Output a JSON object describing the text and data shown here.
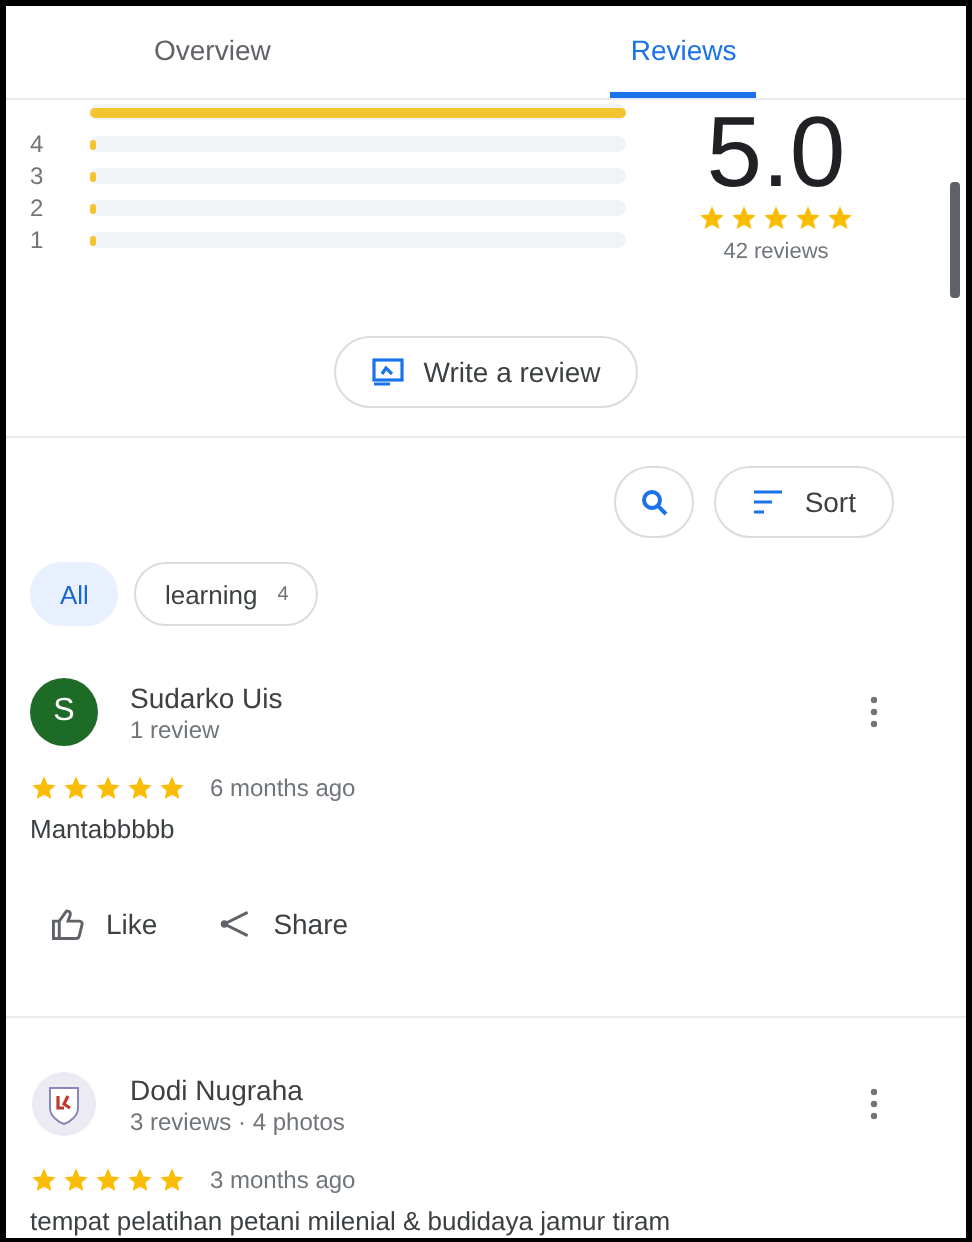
{
  "tabs": [
    {
      "label": "Overview",
      "selected": false
    },
    {
      "label": "Reviews",
      "selected": true
    }
  ],
  "histogram": [
    {
      "level": 1.0
    },
    {
      "label": "4",
      "level": 0.01
    },
    {
      "label": "3",
      "level": 0.01
    },
    {
      "label": "2",
      "level": 0.01
    },
    {
      "label": "1",
      "level": 0.01
    }
  ],
  "summary": {
    "score": "5.0",
    "stars": 5,
    "count": "42 reviews"
  },
  "write_review": "Write a review",
  "sort": "Sort",
  "chips": [
    {
      "label": "All",
      "selected": true
    },
    {
      "label": "learning",
      "count": "4",
      "selected": false
    }
  ],
  "reviews": [
    {
      "kind": "letter",
      "initial": "S",
      "name": "Sudarko Uis",
      "meta": "1 review",
      "stars": 5,
      "time": "6 months ago",
      "text": "Mantabbbbb",
      "actions": [
        "Like",
        "Share"
      ]
    },
    {
      "kind": "emblem",
      "name": "Dodi Nugraha",
      "meta": "3 reviews · 4 photos",
      "stars": 5,
      "time": "3 months ago",
      "text": "tempat pelatihan petani milenial & budidaya jamur tiram"
    }
  ]
}
